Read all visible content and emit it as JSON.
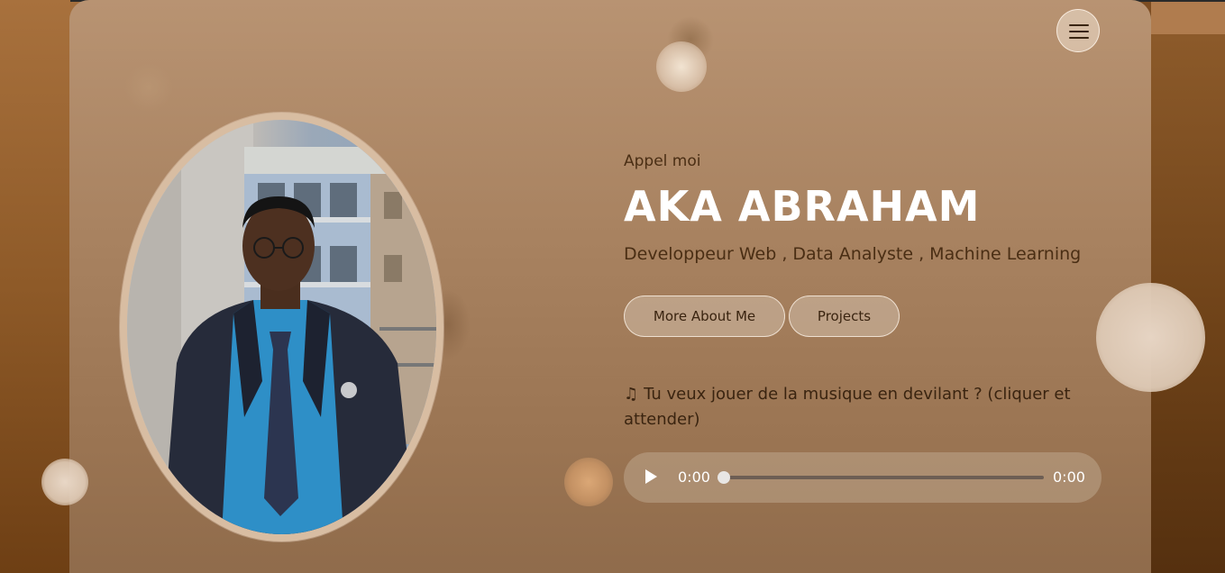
{
  "header": {
    "menu_icon": "hamburger-menu-icon"
  },
  "hero": {
    "intro": "Appel moi",
    "name": "AKA ABRAHAM",
    "roles": "Developpeur Web , Data Analyste , Machine Learning",
    "buttons": {
      "about_label": "More About Me",
      "projects_label": "Projects"
    },
    "music_prompt": "Tu veux jouer de la musique en devilant ? (cliquer et attender)",
    "music_icon": "music-note-icon"
  },
  "audio_player": {
    "current_time": "0:00",
    "duration": "0:00",
    "progress": 0
  },
  "colors": {
    "accent_text": "#4a2e14",
    "name_text": "#ffffff"
  }
}
